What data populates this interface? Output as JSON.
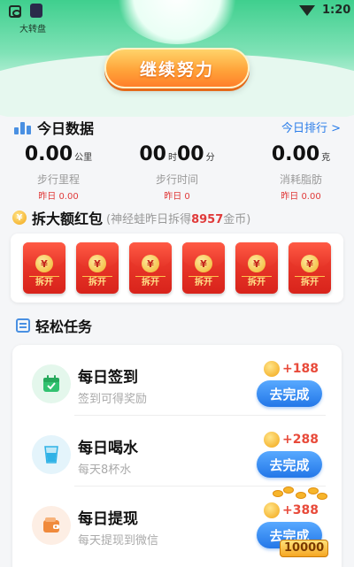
{
  "status_bar": {
    "time": "1:20"
  },
  "banner": {
    "turntable_label": "大转盘",
    "continue_button": "继续努力"
  },
  "today": {
    "title": "今日数据",
    "ranking_link": "今日排行 >",
    "stats": [
      {
        "value": "0.00",
        "unit": "公里",
        "name": "步行里程",
        "yesterday": "昨日 0.00"
      },
      {
        "value_a": "00",
        "unit_a": "时",
        "value_b": "00",
        "unit_b": "分",
        "name": "步行时间",
        "yesterday": "昨日 0"
      },
      {
        "value": "0.00",
        "unit": "克",
        "name": "消耗脂肪",
        "yesterday": "昨日 0.00"
      }
    ]
  },
  "red_packets": {
    "title": "拆大额红包",
    "sub_prefix": "(神经蛙昨日拆得",
    "sub_amount": "8957",
    "sub_suffix": "金币)",
    "packet_symbol": "¥",
    "packet_label": "拆开",
    "count": 6
  },
  "tasks": {
    "title": "轻松任务",
    "items": [
      {
        "name": "每日签到",
        "desc": "签到可得奖励",
        "reward": "+188",
        "button": "去完成",
        "icon": "calendar-check-icon",
        "icon_bg": "#e4f7ec",
        "icon_color": "#32c270"
      },
      {
        "name": "每日喝水",
        "desc": "每天8杯水",
        "reward": "+288",
        "button": "去完成",
        "icon": "water-glass-icon",
        "icon_bg": "#e4f4fb",
        "icon_color": "#2fb2e6"
      },
      {
        "name": "每日提现",
        "desc": "每天提现到微信",
        "reward": "+388",
        "button": "去完成",
        "icon": "wallet-icon",
        "icon_bg": "#fdeee4",
        "icon_color": "#f08a3c"
      }
    ]
  },
  "floating_badge": "10000"
}
